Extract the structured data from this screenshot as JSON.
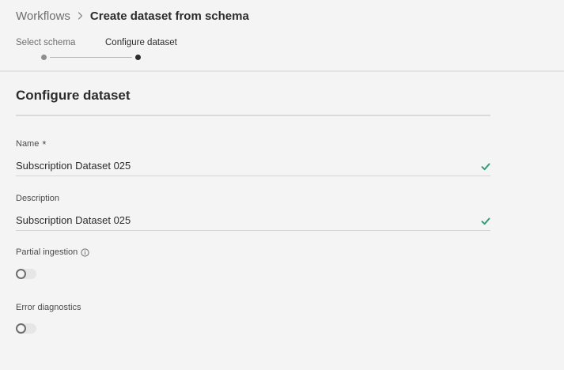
{
  "breadcrumb": {
    "parent": "Workflows",
    "current": "Create dataset from schema"
  },
  "stepper": {
    "steps": [
      {
        "label": "Select schema",
        "status": "complete"
      },
      {
        "label": "Configure dataset",
        "status": "current"
      }
    ]
  },
  "section": {
    "title": "Configure dataset"
  },
  "fields": {
    "name": {
      "label": "Name",
      "required_marker": "*",
      "value": "Subscription Dataset 025",
      "valid": true
    },
    "description": {
      "label": "Description",
      "value": "Subscription Dataset 025",
      "valid": true
    },
    "partial_ingestion": {
      "label": "Partial ingestion",
      "enabled": false,
      "info_icon": "info-icon"
    },
    "error_diagnostics": {
      "label": "Error diagnostics",
      "enabled": false
    }
  },
  "colors": {
    "background": "#f4f4f4",
    "text_primary": "#2c2c2c",
    "text_secondary": "#6e6e6e",
    "valid_check": "#2d9d78"
  }
}
